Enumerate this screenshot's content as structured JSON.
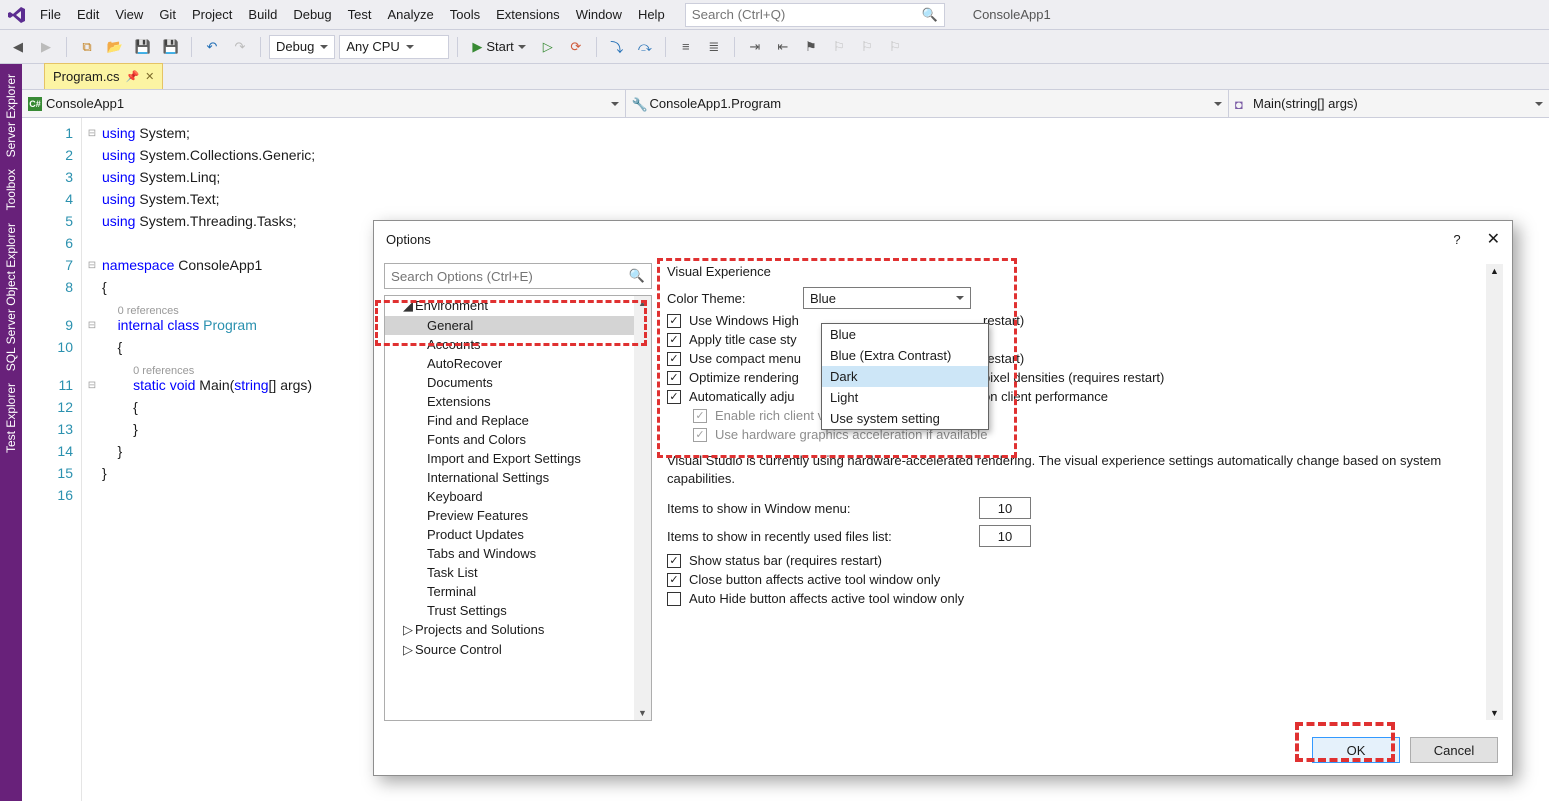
{
  "menu": [
    "File",
    "Edit",
    "View",
    "Git",
    "Project",
    "Build",
    "Debug",
    "Test",
    "Analyze",
    "Tools",
    "Extensions",
    "Window",
    "Help"
  ],
  "search_placeholder": "Search (Ctrl+Q)",
  "app_name": "ConsoleApp1",
  "toolbar": {
    "config": "Debug",
    "platform": "Any CPU",
    "start": "Start"
  },
  "dock_tabs": [
    "Server Explorer",
    "Toolbox",
    "SQL Server Object Explorer",
    "Test Explorer"
  ],
  "doc_tab": "Program.cs",
  "nav": {
    "project": "ConsoleApp1",
    "class": "ConsoleApp1.Program",
    "member": "Main(string[] args)"
  },
  "code": {
    "lines": [
      {
        "n": 1,
        "fold": "⊟",
        "html": "<span class='kw'>using</span> System;"
      },
      {
        "n": 2,
        "fold": "",
        "html": "<span class='kw'>using</span> System.Collections.Generic;"
      },
      {
        "n": 3,
        "fold": "",
        "html": "<span class='kw'>using</span> System.Linq;"
      },
      {
        "n": 4,
        "fold": "",
        "html": "<span class='kw'>using</span> System.Text;"
      },
      {
        "n": 5,
        "fold": "",
        "html": "<span class='kw'>using</span> System.Threading.Tasks;"
      },
      {
        "n": 6,
        "fold": "",
        "html": ""
      },
      {
        "n": 7,
        "fold": "⊟",
        "html": "<span class='kw'>namespace</span> ConsoleApp1"
      },
      {
        "n": 8,
        "fold": "",
        "html": "{"
      },
      {
        "n": "",
        "fold": "",
        "html": "    <span class='ref-lens'>0 references</span>",
        "lens": true
      },
      {
        "n": 9,
        "fold": "⊟",
        "html": "    <span class='kw'>internal</span> <span class='kw'>class</span> <span class='type'>Program</span>"
      },
      {
        "n": 10,
        "fold": "",
        "html": "    {"
      },
      {
        "n": "",
        "fold": "",
        "html": "        <span class='ref-lens'>0 references</span>",
        "lens": true
      },
      {
        "n": 11,
        "fold": "⊟",
        "html": "        <span class='kw'>static</span> <span class='kw'>void</span> Main(<span class='kw'>string</span>[] args)"
      },
      {
        "n": 12,
        "fold": "",
        "html": "        {"
      },
      {
        "n": 13,
        "fold": "",
        "html": "        }"
      },
      {
        "n": 14,
        "fold": "",
        "html": "    }"
      },
      {
        "n": 15,
        "fold": "",
        "html": "}"
      },
      {
        "n": 16,
        "fold": "",
        "html": ""
      }
    ]
  },
  "dialog": {
    "title": "Options",
    "search_placeholder": "Search Options (Ctrl+E)",
    "tree_root": "Environment",
    "tree_children": [
      "General",
      "Accounts",
      "AutoRecover",
      "Documents",
      "Extensions",
      "Find and Replace",
      "Fonts and Colors",
      "Import and Export Settings",
      "International Settings",
      "Keyboard",
      "Preview Features",
      "Product Updates",
      "Tabs and Windows",
      "Task List",
      "Terminal",
      "Trust Settings"
    ],
    "tree_next": [
      "Projects and Solutions",
      "Source Control"
    ],
    "selected_child": "General",
    "group": "Visual Experience",
    "theme_label": "Color Theme:",
    "theme_value": "Blue",
    "theme_options": [
      "Blue",
      "Blue (Extra Contrast)",
      "Dark",
      "Light",
      "Use system setting"
    ],
    "theme_hover": "Dark",
    "checks": [
      {
        "text": "Use Windows High Contrast settings (requires restart)",
        "checked": true,
        "trunc": "Use Windows High"
      },
      {
        "text": "Apply title case styling to menu bar",
        "checked": true,
        "trunc": "Apply title case sty",
        "after": ""
      },
      {
        "text": "Use compact menu and search bar (requires restart)",
        "checked": true,
        "trunc": "Use compact menu",
        "after": "restart)"
      },
      {
        "text": "Optimize rendering for screens with different pixel densities (requires restart)",
        "checked": true,
        "trunc": "Optimize rendering",
        "after": "pixel densities (requires restart)"
      },
      {
        "text": "Automatically adjust visual experience based on client performance",
        "checked": true,
        "trunc": "Automatically adju",
        "after": "on client performance"
      }
    ],
    "subchecks": [
      {
        "text": "Enable rich client visual experience",
        "checked": true
      },
      {
        "text": "Use hardware graphics acceleration if available",
        "checked": true
      }
    ],
    "note": "Visual Studio is currently using hardware-accelerated rendering. The visual experience settings automatically change based on system capabilities.",
    "win_items_label": "Items to show in Window menu:",
    "win_items": "10",
    "mru_label": "Items to show in recently used files list:",
    "mru": "10",
    "checks2": [
      {
        "text": "Show status bar (requires restart)",
        "checked": true
      },
      {
        "text": "Close button affects active tool window only",
        "checked": true
      },
      {
        "text": "Auto Hide button affects active tool window only",
        "checked": false
      }
    ],
    "ok": "OK",
    "cancel": "Cancel"
  }
}
